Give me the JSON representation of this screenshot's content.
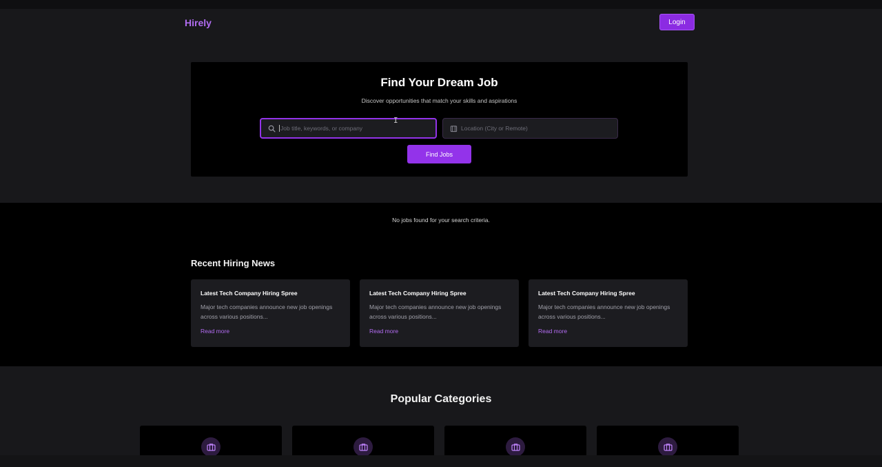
{
  "header": {
    "brand": "Hirely",
    "login_label": "Login"
  },
  "hero": {
    "title": "Find Your Dream Job",
    "subtitle": "Discover opportunities that match your skills and aspirations",
    "job_placeholder": "Job title, keywords, or company",
    "location_placeholder": "Location (City or Remote)",
    "find_label": "Find Jobs"
  },
  "results": {
    "empty_message": "No jobs found for your search criteria."
  },
  "news": {
    "title": "Recent Hiring News",
    "cards": [
      {
        "title": "Latest Tech Company Hiring Spree",
        "body": "Major tech companies announce new job openings across various positions...",
        "link": "Read more"
      },
      {
        "title": "Latest Tech Company Hiring Spree",
        "body": "Major tech companies announce new job openings across various positions...",
        "link": "Read more"
      },
      {
        "title": "Latest Tech Company Hiring Spree",
        "body": "Major tech companies announce new job openings across various positions...",
        "link": "Read more"
      }
    ]
  },
  "categories": {
    "title": "Popular Categories",
    "items": [
      {
        "icon": "briefcase-icon"
      },
      {
        "icon": "briefcase-icon"
      },
      {
        "icon": "briefcase-icon"
      },
      {
        "icon": "briefcase-icon"
      }
    ]
  },
  "colors": {
    "accent": "#9333ea",
    "brand": "#b06cf0",
    "background": "#18181b"
  }
}
